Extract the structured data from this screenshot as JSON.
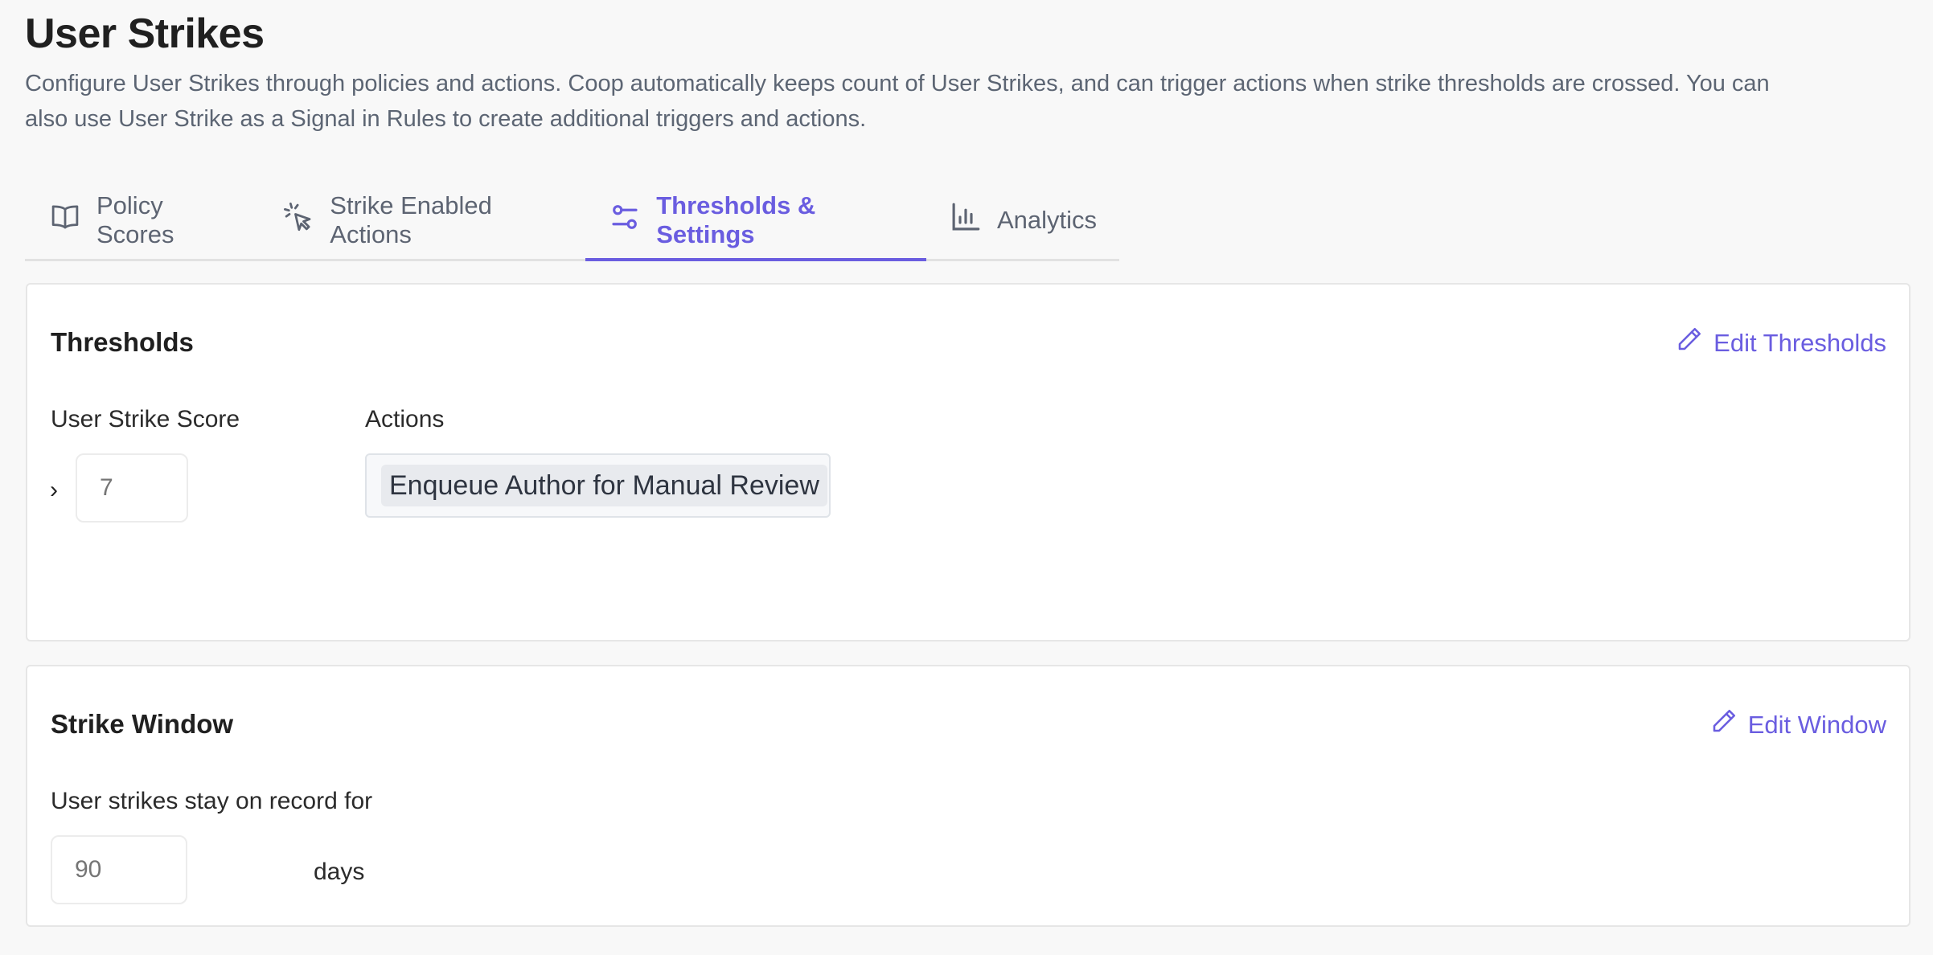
{
  "page": {
    "title": "User Strikes",
    "description": "Configure User Strikes through policies and actions. Coop automatically keeps count of User Strikes, and can trigger actions when strike thresholds are crossed. You can also use User Strike as a Signal in Rules to create additional triggers and actions."
  },
  "tabs": [
    {
      "label": "Policy Scores",
      "icon": "book-open-icon",
      "active": false
    },
    {
      "label": "Strike Enabled Actions",
      "icon": "cursor-click-icon",
      "active": false
    },
    {
      "label": "Thresholds & Settings",
      "icon": "sliders-icon",
      "active": true
    },
    {
      "label": "Analytics",
      "icon": "bar-chart-icon",
      "active": false
    }
  ],
  "thresholds": {
    "heading": "Thresholds",
    "edit_label": "Edit Thresholds",
    "score_label": "User Strike Score",
    "actions_label": "Actions",
    "operator": "›",
    "score_placeholder": "7",
    "action_tag": "Enqueue Author for Manual Review"
  },
  "strike_window": {
    "heading": "Strike Window",
    "edit_label": "Edit Window",
    "description": "User strikes stay on record for",
    "days_placeholder": "90",
    "unit": "days"
  },
  "colors": {
    "accent": "#6a5de0",
    "background": "#f8f8f8",
    "muted_text": "#5c6573"
  }
}
